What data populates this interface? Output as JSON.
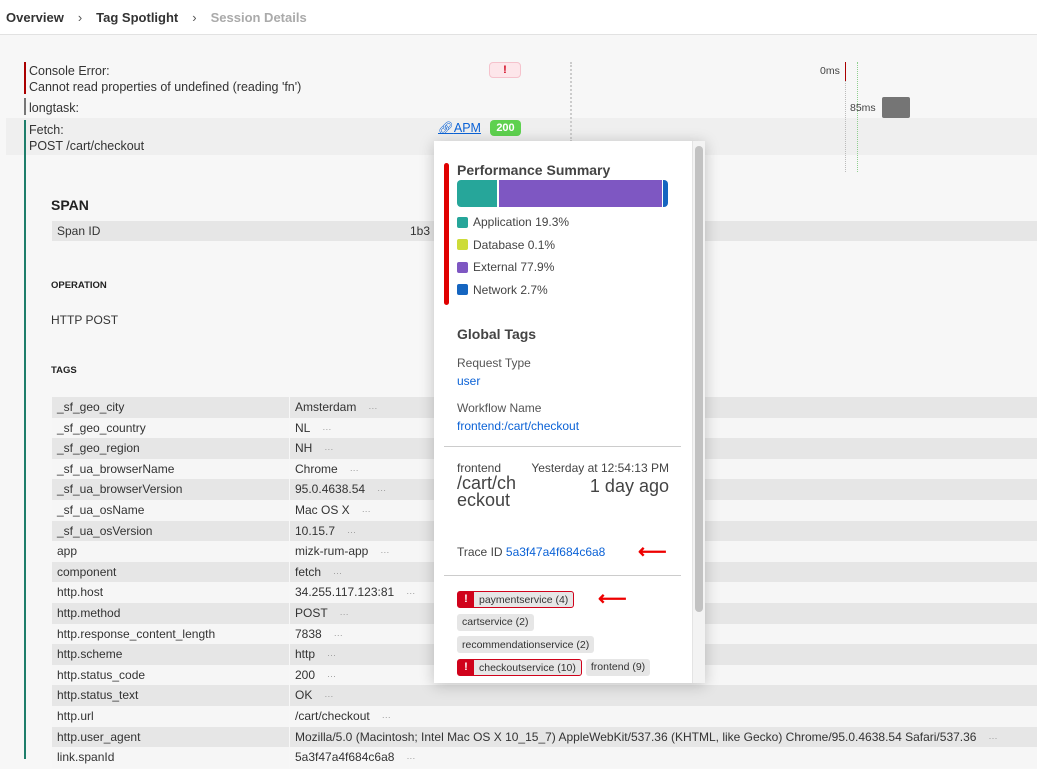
{
  "breadcrumb": [
    "Overview",
    "Tag Spotlight",
    "Session Details"
  ],
  "events": {
    "console_error": {
      "label": "Console Error:",
      "message": "Cannot read properties of undefined (reading 'fn')",
      "badge": "!",
      "time": "0ms"
    },
    "longtask": {
      "label": "longtask:",
      "time": "85ms"
    },
    "fetch": {
      "label": "Fetch:",
      "request": "POST /cart/checkout",
      "apm_link": "APM",
      "status": "200"
    }
  },
  "span": {
    "title": "SPAN",
    "span_id_label": "Span ID",
    "span_id_value": "1b3",
    "operation_title": "OPERATION",
    "operation": "HTTP POST",
    "tags_title": "TAGS"
  },
  "tags": [
    {
      "k": "_sf_geo_city",
      "v": "Amsterdam"
    },
    {
      "k": "_sf_geo_country",
      "v": "NL"
    },
    {
      "k": "_sf_geo_region",
      "v": "NH"
    },
    {
      "k": "_sf_ua_browserName",
      "v": "Chrome"
    },
    {
      "k": "_sf_ua_browserVersion",
      "v": "95.0.4638.54"
    },
    {
      "k": "_sf_ua_osName",
      "v": "Mac OS X"
    },
    {
      "k": "_sf_ua_osVersion",
      "v": "10.15.7"
    },
    {
      "k": "app",
      "v": "mizk-rum-app"
    },
    {
      "k": "component",
      "v": "fetch"
    },
    {
      "k": "http.host",
      "v": "34.255.117.123:81"
    },
    {
      "k": "http.method",
      "v": "POST"
    },
    {
      "k": "http.response_content_length",
      "v": "7838"
    },
    {
      "k": "http.scheme",
      "v": "http"
    },
    {
      "k": "http.status_code",
      "v": "200"
    },
    {
      "k": "http.status_text",
      "v": "OK"
    },
    {
      "k": "http.url",
      "v": "/cart/checkout"
    },
    {
      "k": "http.user_agent",
      "v": "Mozilla/5.0 (Macintosh; Intel Mac OS X 10_15_7) AppleWebKit/537.36 (KHTML, like Gecko) Chrome/95.0.4638.54 Safari/537.36"
    },
    {
      "k": "link.spanId",
      "v": "5a3f47a4f684c6a8"
    }
  ],
  "popup": {
    "perf_title": "Performance Summary",
    "breakdown": [
      {
        "name": "Application",
        "pct": 19.3,
        "label": "19.3%",
        "color": "#26a69a"
      },
      {
        "name": "Database",
        "pct": 0.1,
        "label": "0.1%",
        "color": "#cddc39"
      },
      {
        "name": "External",
        "pct": 77.9,
        "label": "77.9%",
        "color": "#7e57c2"
      },
      {
        "name": "Network",
        "pct": 2.7,
        "label": "2.7%",
        "color": "#1565c0"
      }
    ],
    "global_tags_title": "Global Tags",
    "request_type_label": "Request Type",
    "request_type": "user",
    "workflow_label": "Workflow Name",
    "workflow": "frontend:/cart/checkout",
    "service": "frontend",
    "when": "Yesterday at 12:54:13 PM",
    "endpoint": "/cart/checkout",
    "ago": "1 day ago",
    "trace_label": "Trace ID",
    "trace_id": "5a3f47a4f684c6a8",
    "services": [
      {
        "name": "paymentservice (4)",
        "error": true
      },
      {
        "name": "cartservice (2)",
        "error": false
      },
      {
        "name": "recommendationservice (2)",
        "error": false
      },
      {
        "name": "checkoutservice (10)",
        "error": true
      },
      {
        "name": "frontend (9)",
        "error": false
      }
    ]
  },
  "colors": {
    "error": "#d0021b",
    "link": "#0b62d6",
    "success": "#5ed14f",
    "fetch_bar": "#1e7e6b"
  }
}
